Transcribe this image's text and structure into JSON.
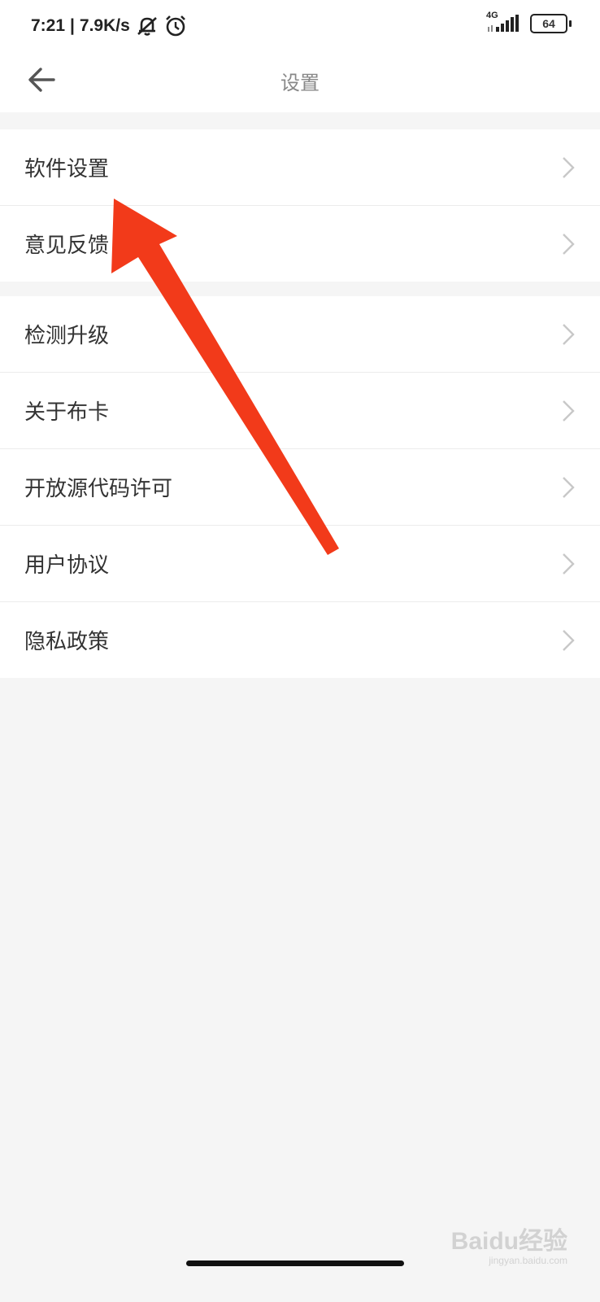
{
  "status": {
    "time": "7:21",
    "separator": "|",
    "speed": "7.9K/s",
    "network": "4G",
    "battery": "64",
    "icons": [
      "mute-bell-icon",
      "alarm-icon",
      "signal-icon",
      "battery-icon"
    ]
  },
  "header": {
    "title": "设置",
    "back_icon": "arrow-left-icon"
  },
  "group1": [
    {
      "label": "软件设置"
    },
    {
      "label": "意见反馈"
    }
  ],
  "group2": [
    {
      "label": "检测升级"
    },
    {
      "label": "关于布卡"
    },
    {
      "label": "开放源代码许可"
    },
    {
      "label": "用户协议"
    },
    {
      "label": "隐私政策"
    }
  ],
  "annotation": {
    "color": "#f23a1a",
    "points_to": "软件设置"
  },
  "watermark": {
    "brand": "Baidu经验",
    "url": "jingyan.baidu.com"
  },
  "colors": {
    "background": "#f5f5f5",
    "text": "#333333",
    "chevron": "#c8c8c8"
  }
}
